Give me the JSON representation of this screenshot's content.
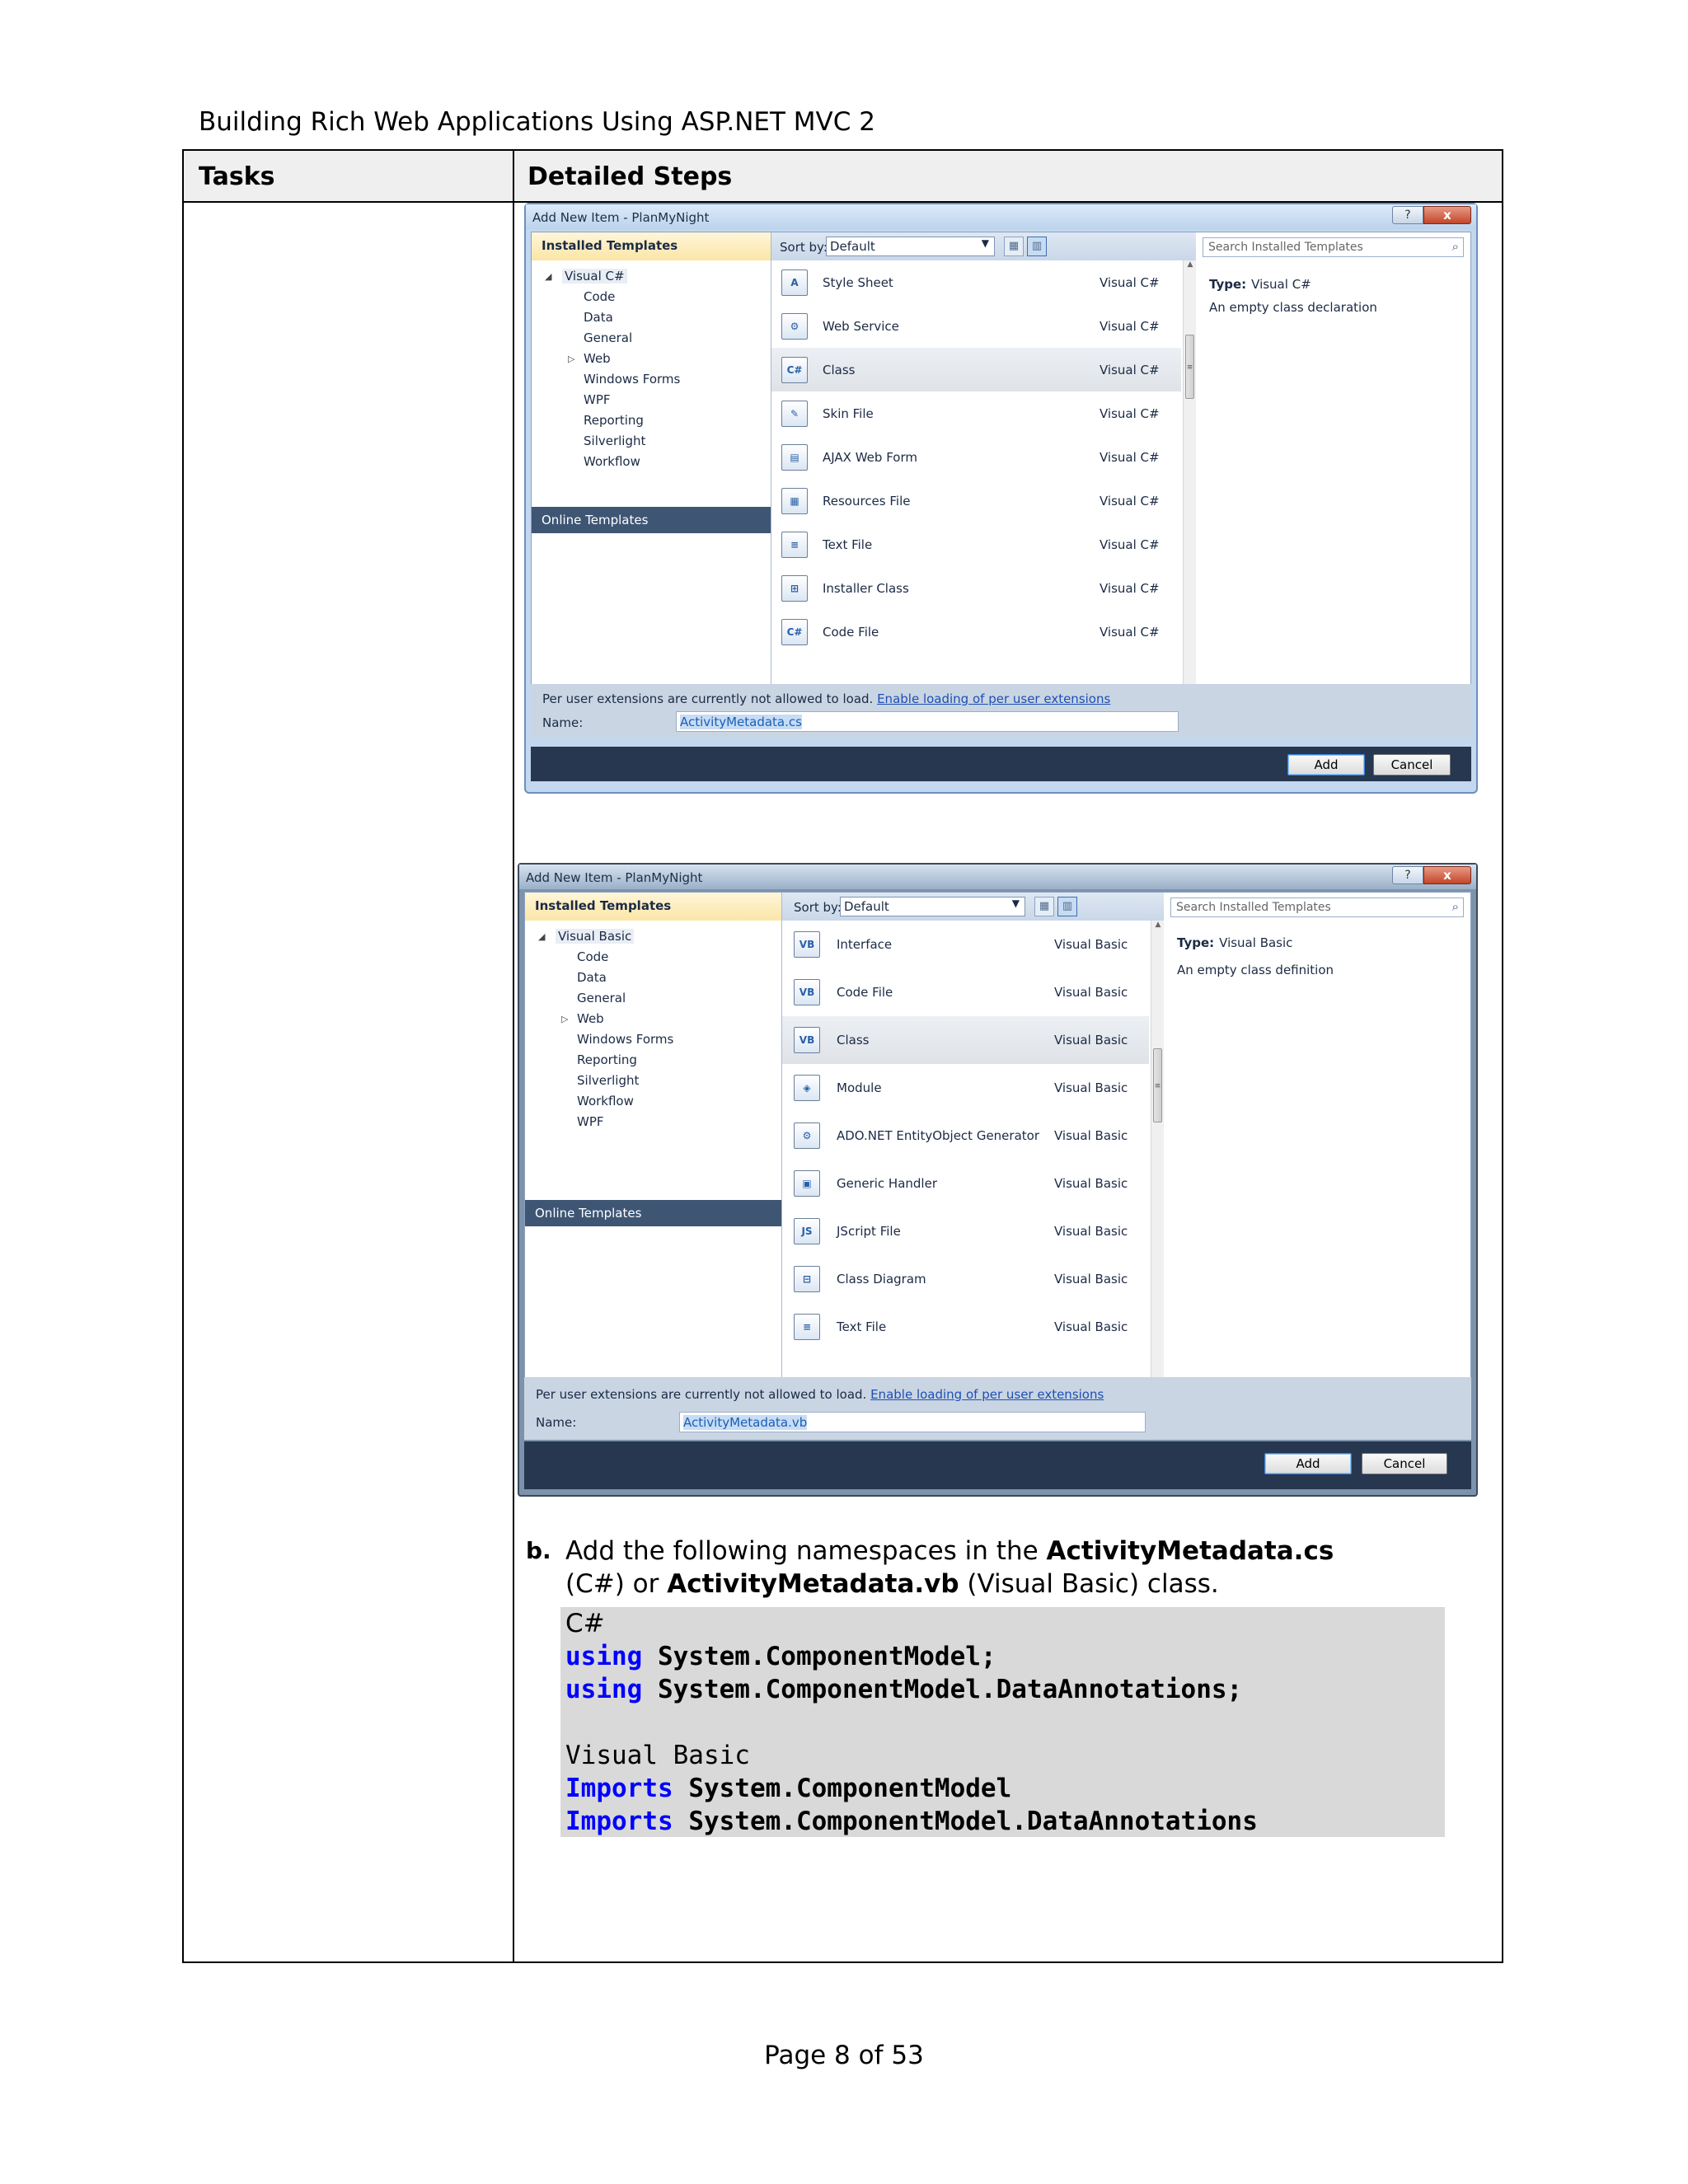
{
  "document": {
    "header": "Building Rich Web Applications Using ASP.NET MVC 2",
    "footer": "Page 8 of 53",
    "table": {
      "col_tasks": "Tasks",
      "col_steps": "Detailed Steps"
    }
  },
  "dialog_cs": {
    "title": "Add New Item - PlanMyNight",
    "help_glyph": "?",
    "close_glyph": "x",
    "installed_templates": "Installed Templates",
    "tree_root": "Visual C#",
    "tree_children": [
      "Code",
      "Data",
      "General",
      "Web",
      "Windows Forms",
      "WPF",
      "Reporting",
      "Silverlight",
      "Workflow"
    ],
    "online_templates": "Online Templates",
    "sort_label": "Sort by:",
    "sort_value": "Default",
    "search_placeholder": "Search Installed Templates",
    "templates": [
      {
        "name": "Style Sheet",
        "lang": "Visual C#",
        "icon": "style-sheet-icon"
      },
      {
        "name": "Web Service",
        "lang": "Visual C#",
        "icon": "web-service-icon"
      },
      {
        "name": "Class",
        "lang": "Visual C#",
        "icon": "class-icon"
      },
      {
        "name": "Skin File",
        "lang": "Visual C#",
        "icon": "skin-file-icon"
      },
      {
        "name": "AJAX Web Form",
        "lang": "Visual C#",
        "icon": "ajax-web-form-icon"
      },
      {
        "name": "Resources File",
        "lang": "Visual C#",
        "icon": "resources-file-icon"
      },
      {
        "name": "Text File",
        "lang": "Visual C#",
        "icon": "text-file-icon"
      },
      {
        "name": "Installer Class",
        "lang": "Visual C#",
        "icon": "installer-class-icon"
      },
      {
        "name": "Code File",
        "lang": "Visual C#",
        "icon": "code-file-icon"
      }
    ],
    "type_label": "Type:",
    "type_value": "Visual C#",
    "description": "An empty class declaration",
    "ext_message": "Per user extensions are currently not allowed to load.",
    "ext_link": "Enable loading of per user extensions",
    "name_label": "Name:",
    "name_value": "ActivityMetadata.cs",
    "add_button": "Add",
    "cancel_button": "Cancel"
  },
  "dialog_vb": {
    "title": "Add New Item - PlanMyNight",
    "help_glyph": "?",
    "close_glyph": "x",
    "installed_templates": "Installed Templates",
    "tree_root": "Visual Basic",
    "tree_children": [
      "Code",
      "Data",
      "General",
      "Web",
      "Windows Forms",
      "Reporting",
      "Silverlight",
      "Workflow",
      "WPF"
    ],
    "online_templates": "Online Templates",
    "sort_label": "Sort by:",
    "sort_value": "Default",
    "search_placeholder": "Search Installed Templates",
    "templates": [
      {
        "name": "Interface",
        "lang": "Visual Basic",
        "icon": "interface-icon"
      },
      {
        "name": "Code File",
        "lang": "Visual Basic",
        "icon": "code-file-icon"
      },
      {
        "name": "Class",
        "lang": "Visual Basic",
        "icon": "class-icon"
      },
      {
        "name": "Module",
        "lang": "Visual Basic",
        "icon": "module-icon"
      },
      {
        "name": "ADO.NET EntityObject Generator",
        "lang": "Visual Basic",
        "icon": "entity-generator-icon"
      },
      {
        "name": "Generic Handler",
        "lang": "Visual Basic",
        "icon": "generic-handler-icon"
      },
      {
        "name": "JScript File",
        "lang": "Visual Basic",
        "icon": "jscript-file-icon"
      },
      {
        "name": "Class Diagram",
        "lang": "Visual Basic",
        "icon": "class-diagram-icon"
      },
      {
        "name": "Text File",
        "lang": "Visual Basic",
        "icon": "text-file-icon"
      }
    ],
    "type_label": "Type:",
    "type_value": "Visual Basic",
    "description": "An empty class definition",
    "ext_message": "Per user extensions are currently not allowed to load.",
    "ext_link": "Enable loading of per user extensions",
    "name_label": "Name:",
    "name_value": "ActivityMetadata.vb",
    "add_button": "Add",
    "cancel_button": "Cancel"
  },
  "step_b": {
    "marker": "b.",
    "text_1": "Add the following namespaces in the ",
    "file_cs": "ActivityMetadata.cs",
    "text_2": " (C#) or ",
    "file_vb": "ActivityMetadata.vb",
    "text_3": " (Visual Basic) class."
  },
  "code": {
    "cs_label": "C#",
    "cs_lines": [
      {
        "kw": "using",
        "rest": " System.ComponentModel;"
      },
      {
        "kw": "using",
        "rest": " System.ComponentModel.DataAnnotations;"
      }
    ],
    "vb_label": "Visual Basic",
    "vb_lines": [
      {
        "kw": "Imports",
        "rest": " System.ComponentModel"
      },
      {
        "kw": "Imports",
        "rest": " System.ComponentModel.DataAnnotations"
      }
    ]
  }
}
